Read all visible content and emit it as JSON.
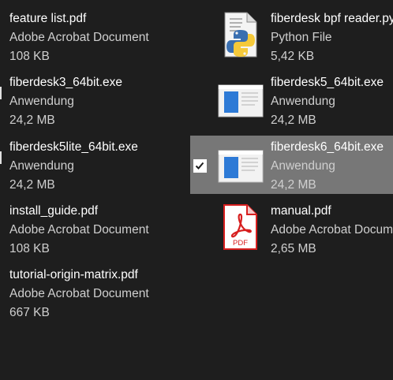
{
  "files": [
    {
      "name": "feature list.pdf",
      "type": "Adobe Acrobat Document",
      "size": "108 KB"
    },
    {
      "name": "fiberdesk bpf reader.py",
      "type": "Python File",
      "size": "5,42 KB",
      "icon": "python-file-icon"
    },
    {
      "name": "fiberdesk3_64bit.exe",
      "type": "Anwendung",
      "size": "24,2 MB"
    },
    {
      "name": "fiberdesk5_64bit.exe",
      "type": "Anwendung",
      "size": "24,2 MB",
      "icon": "application-window-icon"
    },
    {
      "name": "fiberdesk5lite_64bit.exe",
      "type": "Anwendung",
      "size": "24,2 MB"
    },
    {
      "name": "fiberdesk6_64bit.exe",
      "type": "Anwendung",
      "size": "24,2 MB",
      "icon": "application-window-icon",
      "selected": true,
      "checked": true
    },
    {
      "name": "install_guide.pdf",
      "type": "Adobe Acrobat Document",
      "size": "108 KB"
    },
    {
      "name": "manual.pdf",
      "type": "Adobe Acrobat Document",
      "size": "2,65 MB",
      "icon": "pdf-file-icon",
      "icon_label": "PDF"
    },
    {
      "name": "tutorial-origin-matrix.pdf",
      "type": "Adobe Acrobat Document",
      "size": "667 KB"
    }
  ],
  "colors": {
    "background": "#1e1e1e",
    "selection": "#777777",
    "primary_text": "#ffffff",
    "secondary_text": "#cfcfcf",
    "pdf_red": "#d71e1e",
    "app_blue": "#2d7ad6"
  }
}
